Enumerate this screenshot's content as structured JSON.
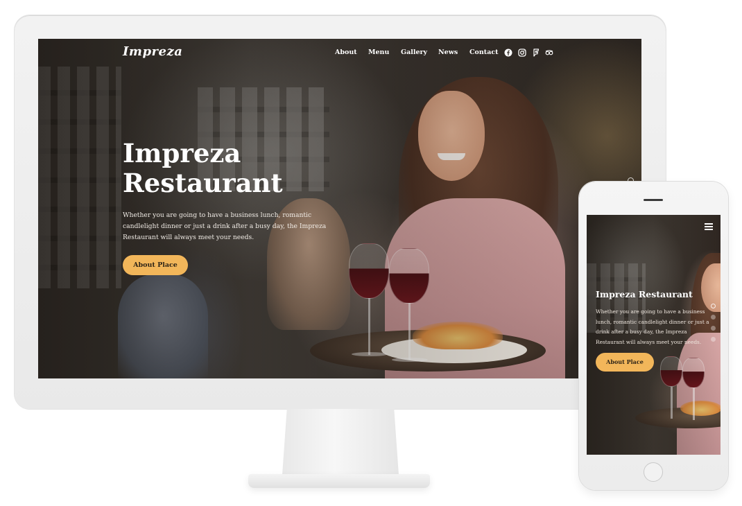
{
  "site": {
    "logo": "Impreza",
    "nav": [
      "About",
      "Menu",
      "Gallery",
      "News",
      "Contact"
    ],
    "social_icons": [
      "facebook-icon",
      "instagram-icon",
      "foursquare-icon",
      "tripadvisor-icon"
    ]
  },
  "hero": {
    "title_line1": "Impreza",
    "title_line2": "Restaurant",
    "text": "Whether you are going to have a business lunch, romantic candlelight dinner or just a drink after a busy day, the Impreza Restaurant will always meet your needs.",
    "button": "About Place"
  },
  "mobile": {
    "title": "Impreza Restaurant",
    "text": "Whether you are going to have a business lunch, romantic candlelight dinner or just a drink after a busy day, the Impreza Restaurant will always meet your needs.",
    "button": "About Place",
    "slide_dots": 4,
    "active_dot": 1
  },
  "colors": {
    "accent": "#f2b65a",
    "device_frame": "#ededed",
    "text_light": "#ffffff"
  }
}
